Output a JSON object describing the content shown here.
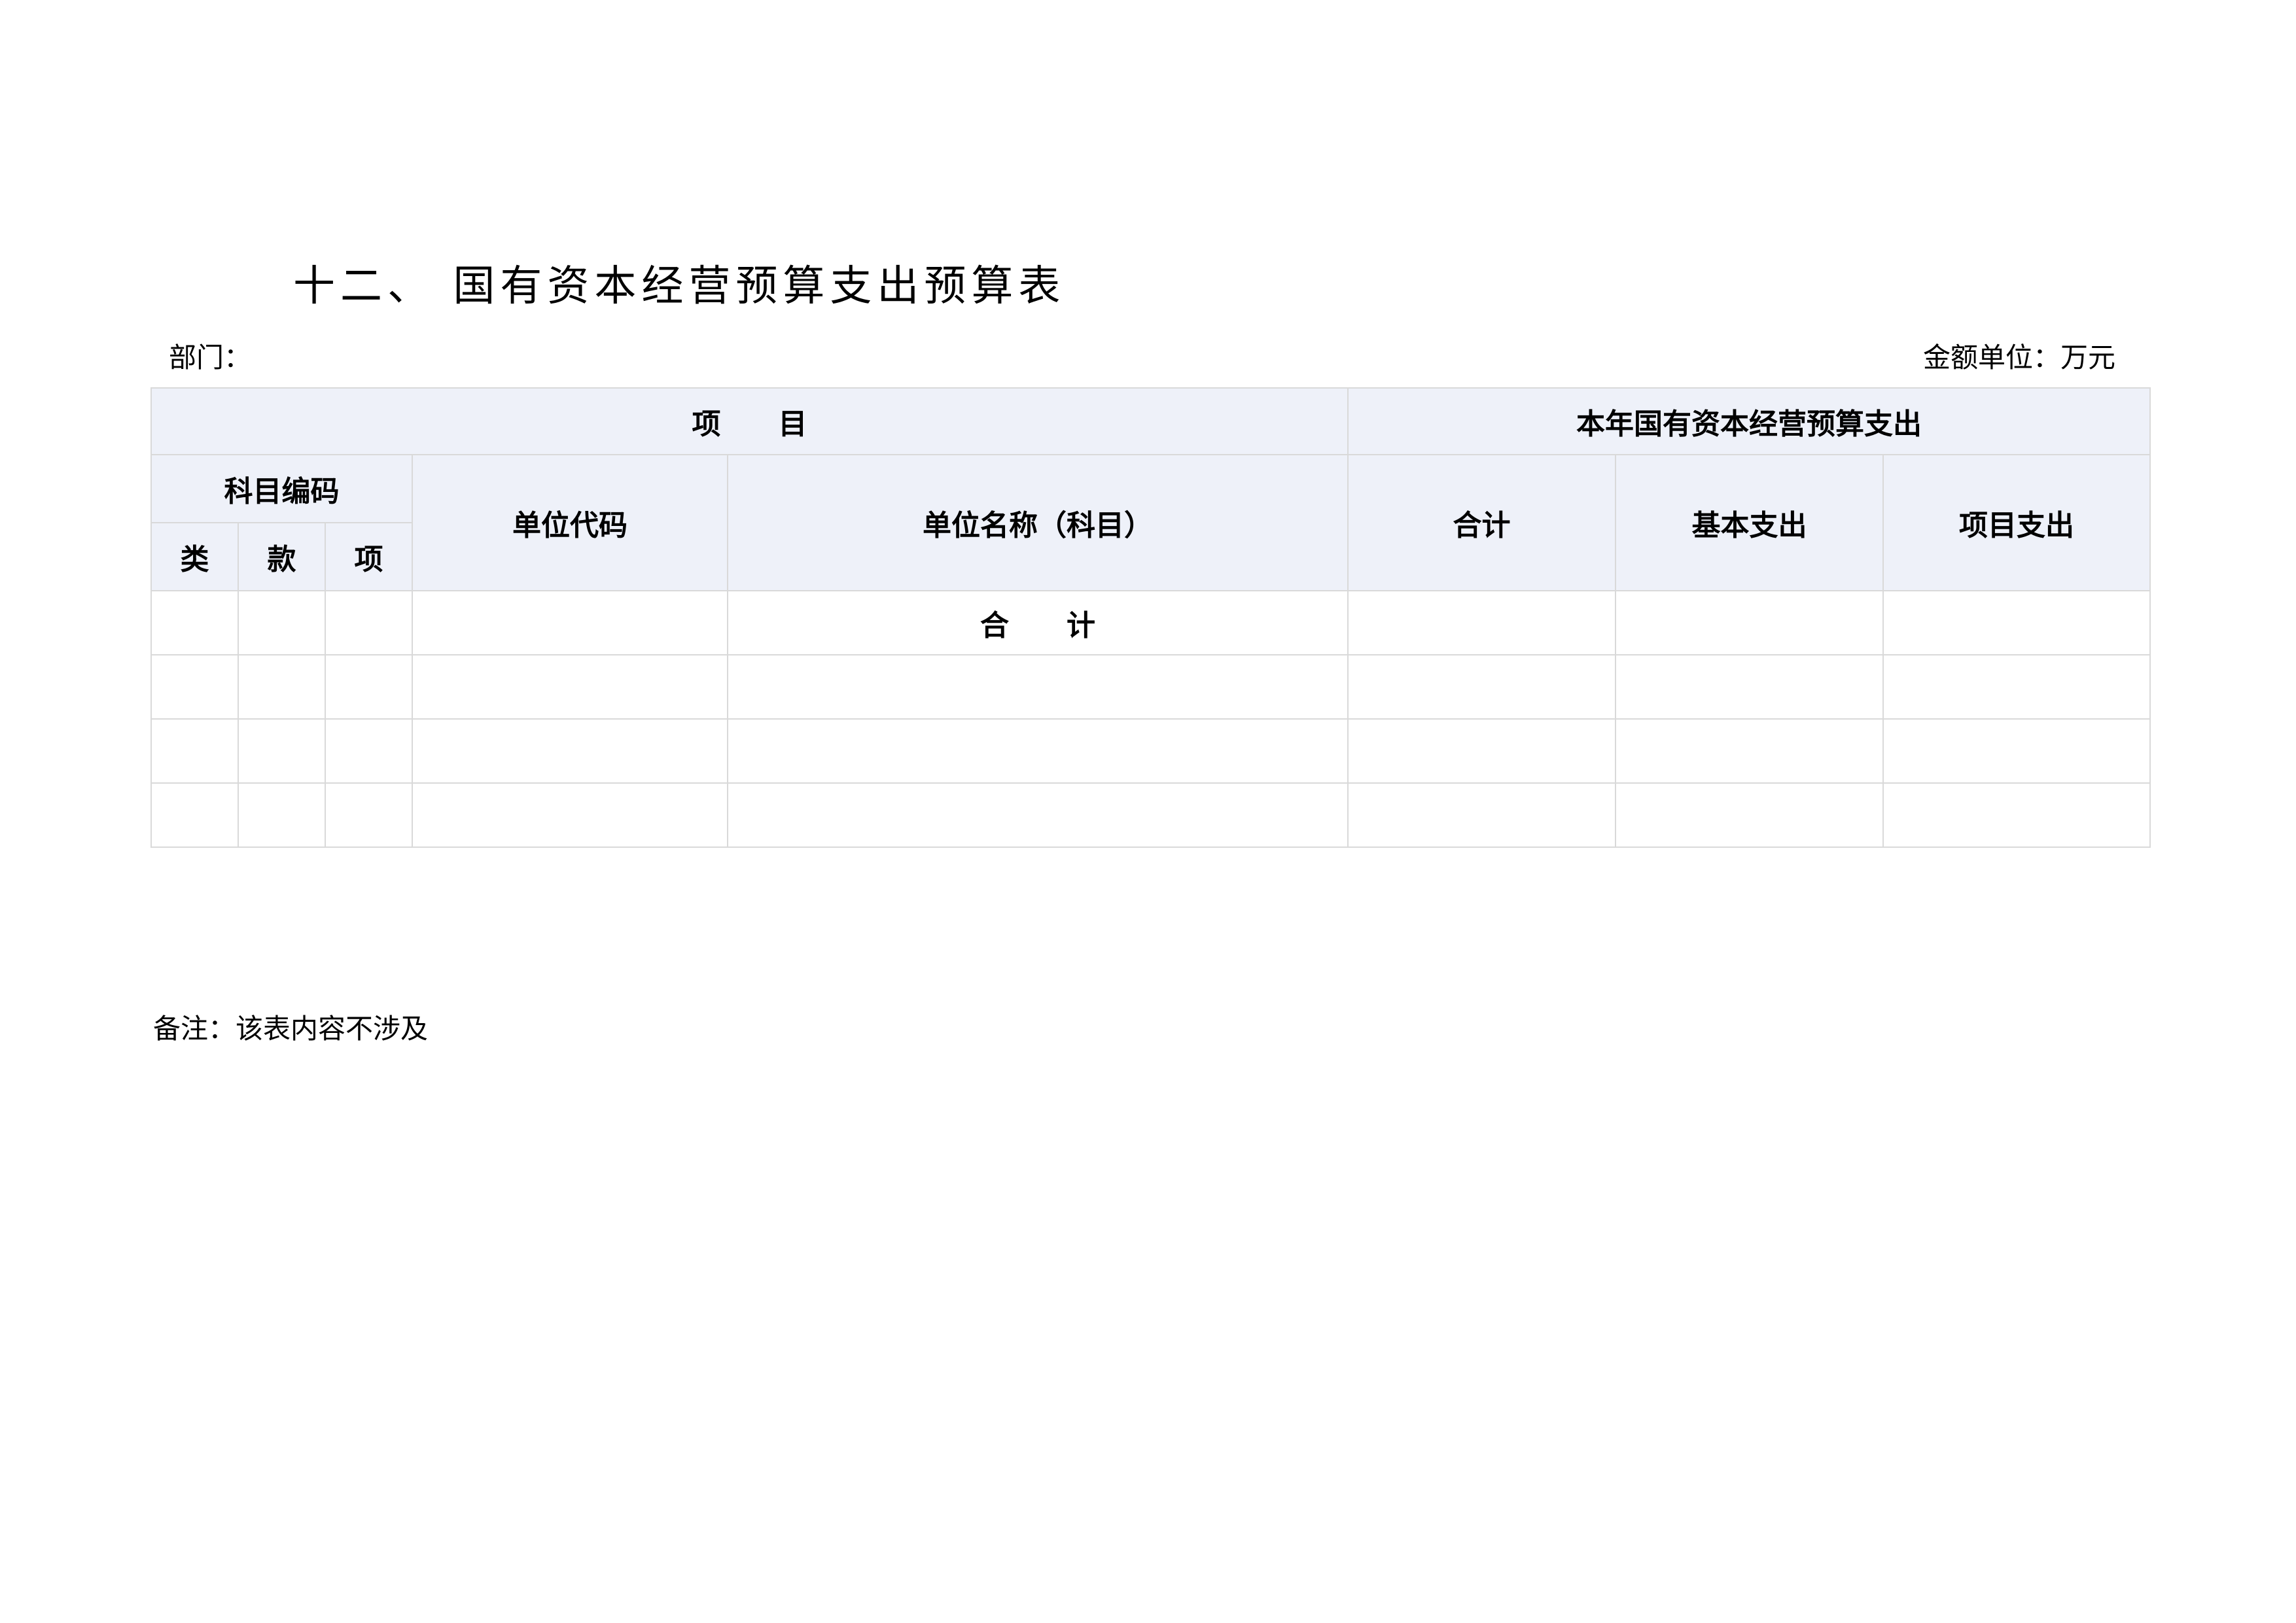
{
  "title": "十二、 国有资本经营预算支出预算表",
  "department_label": "部门：",
  "unit_label": "金额单位：万元",
  "table": {
    "header_item": "项　　目",
    "header_expense": "本年国有资本经营预算支出",
    "subject_code": "科目编码",
    "category": "类",
    "section": "款",
    "item": "项",
    "unit_code": "单位代码",
    "unit_name": "单位名称（科目）",
    "total": "合计",
    "basic_expense": "基本支出",
    "project_expense": "项目支出",
    "total_row_label": "合　　计",
    "rows": [
      [
        "",
        "",
        "",
        "",
        "",
        "",
        "",
        ""
      ],
      [
        "",
        "",
        "",
        "",
        "",
        "",
        "",
        ""
      ],
      [
        "",
        "",
        "",
        "",
        "",
        "",
        "",
        ""
      ]
    ]
  },
  "note": "备注：该表内容不涉及"
}
